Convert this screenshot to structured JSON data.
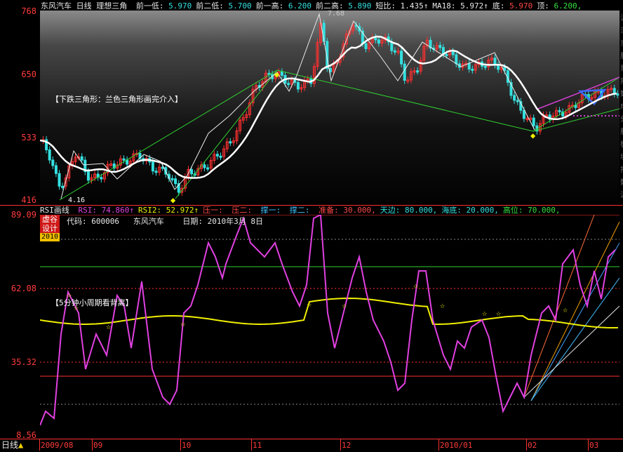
{
  "header": {
    "stock_name": "东风汽车",
    "period": "日线",
    "indicator": "理想三角",
    "items": [
      {
        "label": "前一低:",
        "value": "5.970",
        "color": "#35e0e0"
      },
      {
        "label": "前二低:",
        "value": "5.700",
        "color": "#35e0e0"
      },
      {
        "label": "前一高:",
        "value": "6.200",
        "color": "#35e0e0"
      },
      {
        "label": "前二高:",
        "value": "5.890",
        "color": "#35e0e0"
      },
      {
        "label": "短比:",
        "value": "1.435↑",
        "color": "#e8e8e8"
      },
      {
        "label": "MA18:",
        "value": "5.972↑",
        "color": "#e8e8e8"
      },
      {
        "label": "底:",
        "value": "5.970",
        "color": "#ff4848"
      },
      {
        "label": "顶:",
        "value": "6.200,",
        "color": "#35e040"
      }
    ]
  },
  "main_chart": {
    "y_labels": [
      "768",
      "650",
      "533",
      "416"
    ],
    "annotation": "【下跌三角形：兰色三角形画完介入】",
    "peak_label": "7.68",
    "low_label": "4.16",
    "diamond_marker": "◆"
  },
  "rsi_chart": {
    "title": "RSI画线",
    "params": [
      {
        "label": "RSI:",
        "value": "74.860↑",
        "color": "#e040e0"
      },
      {
        "label": "RSI2:",
        "value": "52.972↑",
        "color": "#f0f000"
      },
      {
        "label": "压一:",
        "value": "",
        "color": "#ff4848"
      },
      {
        "label": "压二:",
        "value": "",
        "color": "#ff4848"
      },
      {
        "label": "撑一:",
        "value": "",
        "color": "#40c0ff"
      },
      {
        "label": "撑二:",
        "value": "",
        "color": "#40c0ff"
      },
      {
        "label": "准备:",
        "value": "30.000,",
        "color": "#ff4848"
      },
      {
        "label": "天边:",
        "value": "80.000,",
        "color": "#35e0e0"
      },
      {
        "label": "海底:",
        "value": "20.000,",
        "color": "#35e0e0"
      },
      {
        "label": "高位:",
        "value": "70.000,",
        "color": "#35e040"
      }
    ],
    "code_label": "代码:",
    "code": "600006",
    "name": "东风汽车",
    "date_label": "日期:",
    "date": "2010年3月 8日",
    "badge_line1": "虚谷",
    "badge_line2": "设计",
    "badge_year": "2010",
    "annotation": "【5分钟小周期看背离】",
    "y_labels": [
      "89.09",
      "62.08",
      "35.32",
      "8.56"
    ],
    "star_marker": "☆"
  },
  "x_axis": {
    "period_button": "日线",
    "labels": [
      "2009/08",
      "09",
      "10",
      "11",
      "12",
      "2010/01",
      "02",
      "03"
    ]
  },
  "colors": {
    "up_candle": "#ff3030",
    "down_candle": "#35e0e0",
    "ma_line": "#ffffff",
    "rsi_line": "#e040e0",
    "rsi2_line": "#f0f000",
    "triangle_line": "#30d030",
    "axis_red": "#ff3030"
  }
}
